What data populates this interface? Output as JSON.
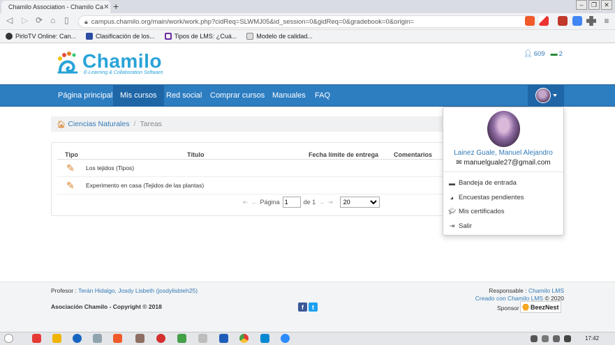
{
  "browser": {
    "tab_title": "Chamilo Association - Chamilo Ca",
    "tab_close": "✕",
    "new_tab": "+",
    "url": "campus.chamilo.org/main/work/work.php?cidReq=SLWMJ05&id_session=0&gidReq=0&gradebook=0&origin=",
    "bookmarks": [
      "PirloTV Online: Can...",
      "Clasificación de los...",
      "Tipos de LMS: ¿Cuá...",
      "Modelo de calidad..."
    ]
  },
  "site": {
    "logo_name": "Chamilo",
    "logo_tagline": "E-Learning & Collaboration Software",
    "stats": {
      "users": "609",
      "online": "2"
    }
  },
  "nav": {
    "items": [
      "Página principal",
      "Mis cursos",
      "Red social",
      "Comprar cursos",
      "Manuales",
      "FAQ"
    ],
    "active": "Mis cursos"
  },
  "breadcrumb": {
    "course": "Ciencias Naturales",
    "current": "Tareas"
  },
  "table": {
    "columns": [
      "Tipo",
      "Título",
      "Fecha límite de entrega",
      "Comentarios"
    ],
    "rows": [
      {
        "title": "Los tejidos (Tipos)"
      },
      {
        "title": "Experimento en casa (Tejidos de las plantas)"
      }
    ],
    "pager": {
      "label": "Página",
      "page": "1",
      "of_text": "de 1",
      "per_page": "20"
    }
  },
  "dropdown": {
    "name": "Lainez Guale, Manuel Alejandro",
    "email": "manuelguale27@gmail.com",
    "items": [
      "Bandeja de entrada",
      "Encuestas pendientes",
      "Mis certificados",
      "Salir"
    ]
  },
  "footer": {
    "teacher_label": "Profesor :",
    "teacher": "Terán Hidalgo, Josdy Lisbeth (josdylisbteh25)",
    "copyright": "Asociación Chamilo - Copyright © 2018",
    "responsible_label": "Responsable :",
    "responsible": "Chamilo LMS",
    "created_with": "Creado con Chamilo LMS",
    "year": "© 2020",
    "sponsor_label": "Sponsor",
    "sponsor": "BeezNest"
  },
  "taskbar": {
    "clock": "17:42"
  },
  "colors": {
    "navbar": "#2d7dc1",
    "nav_active": "#1f66a7",
    "link": "#337ab7",
    "brand": "#29a3d8"
  }
}
